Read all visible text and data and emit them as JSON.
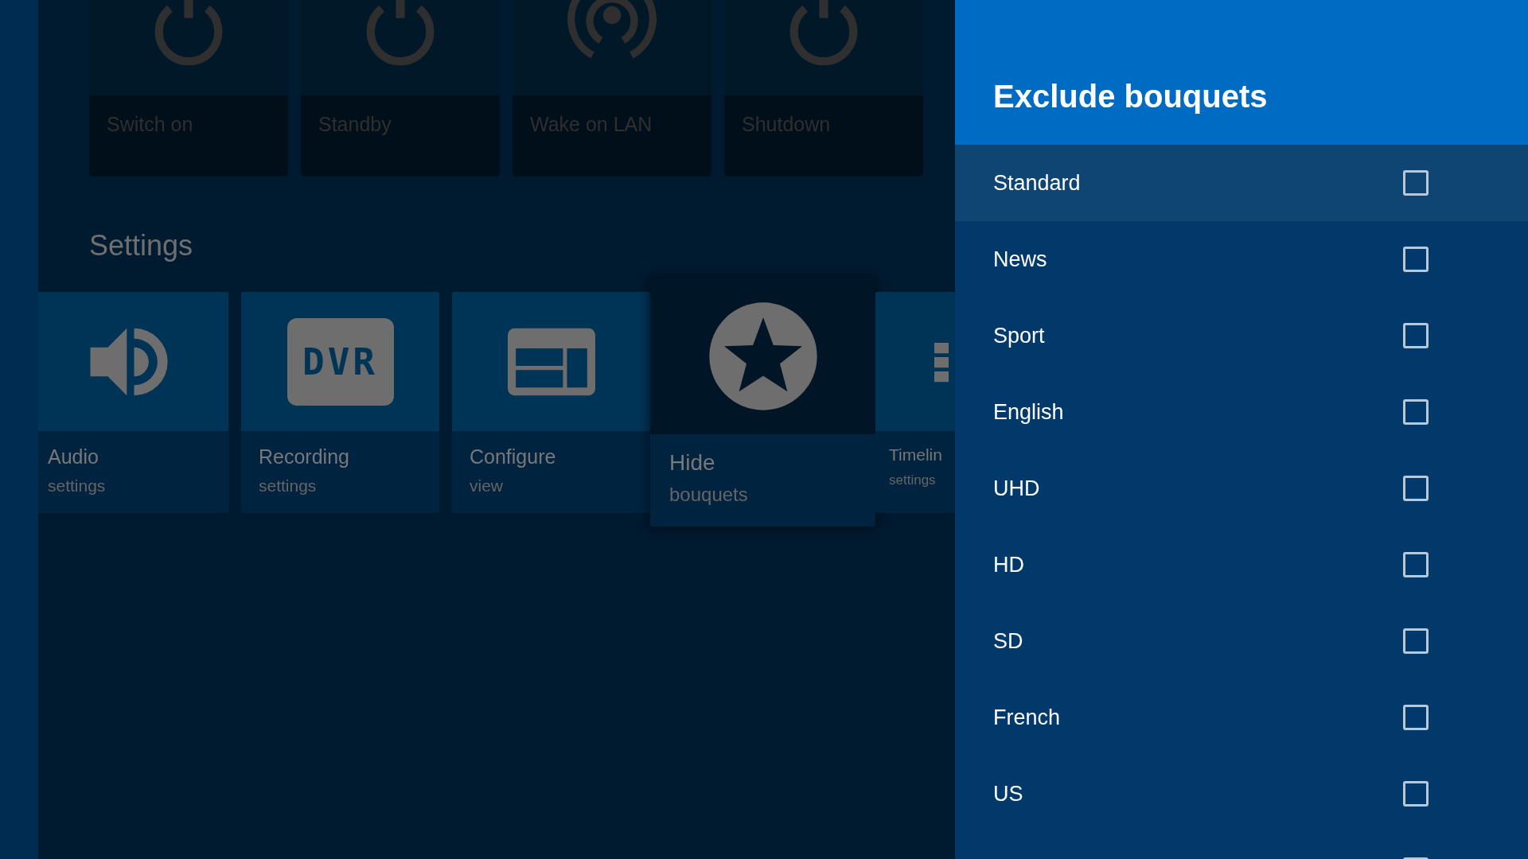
{
  "power_tiles": [
    {
      "kind": "power",
      "label": "Switch on"
    },
    {
      "kind": "power",
      "label": "Standby"
    },
    {
      "kind": "broadcast",
      "label": "Wake on LAN"
    },
    {
      "kind": "power",
      "label": "Shutdown"
    }
  ],
  "settings": {
    "heading": "Settings",
    "tiles": [
      {
        "kind": "speaker",
        "title": "Audio",
        "subtitle": "settings",
        "focused": false
      },
      {
        "kind": "dvr",
        "badge": "DVR",
        "title": "Recording",
        "subtitle": "settings",
        "focused": false
      },
      {
        "kind": "layout",
        "title": "Configure",
        "subtitle": "view",
        "focused": false
      },
      {
        "kind": "star",
        "title": "Hide",
        "subtitle": "bouquets",
        "focused": true
      },
      {
        "kind": "list",
        "title": "Timelin",
        "subtitle": "settings",
        "focused": false
      }
    ]
  },
  "dialog": {
    "title": "Exclude bouquets",
    "items": [
      {
        "label": "Standard",
        "checked": false,
        "selected": true
      },
      {
        "label": "News",
        "checked": false,
        "selected": false
      },
      {
        "label": "Sport",
        "checked": false,
        "selected": false
      },
      {
        "label": "English",
        "checked": false,
        "selected": false
      },
      {
        "label": "UHD",
        "checked": false,
        "selected": false
      },
      {
        "label": "HD",
        "checked": false,
        "selected": false
      },
      {
        "label": "SD",
        "checked": false,
        "selected": false
      },
      {
        "label": "French",
        "checked": false,
        "selected": false
      },
      {
        "label": "US",
        "checked": false,
        "selected": false
      },
      {
        "selected": false
      }
    ]
  }
}
